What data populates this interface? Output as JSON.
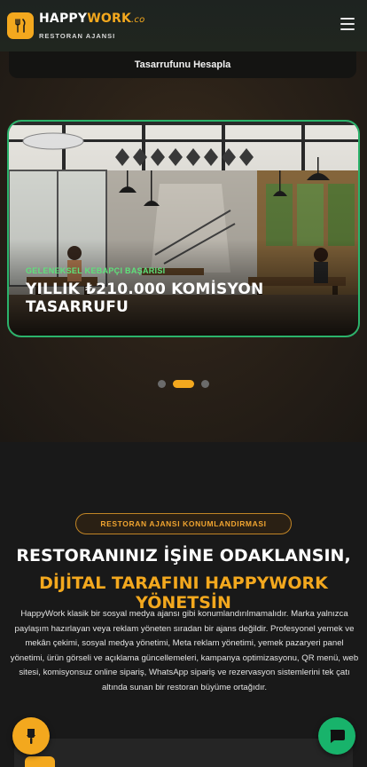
{
  "header": {
    "brand_part1": "HAPPY",
    "brand_part2": "WORK",
    "brand_part3": ".co",
    "subtitle": "RESTORAN AJANSI",
    "logo_icon": "fork-knife-icon",
    "menu_icon": "hamburger-menu-icon"
  },
  "hero": {
    "calc_button": "Tasarrufunu Hesapla",
    "slide": {
      "kicker": "GELENEKSEL KEBAPÇI BAŞARISI",
      "title": "YILLIK ₺210.000 KOMİSYON TASARRUFU",
      "image": "restaurant-interior-photo"
    },
    "dots_total": 3,
    "dots_active": 2
  },
  "section": {
    "pill": "RESTORAN AJANSI KONUMLANDIRMASI",
    "headline_line1": "RESTORANINIZ İŞİNE ODAKLANSIN,",
    "headline_line2": "DİJİTAL TARAFINI HAPPYWORK YÖNETSİN",
    "paragraph": "HappyWork klasik bir sosyal medya ajansı gibi konumlandırılmamalıdır. Marka yalnızca paylaşım hazırlayan veya reklam yöneten sıradan bir ajans değildir. Profesyonel yemek ve mekân çekimi, sosyal medya yönetimi, Meta reklam yönetimi, yemek pazaryeri panel yönetimi, ürün görseli ve açıklama güncellemeleri, kampanya optimizasyonu, QR menü, web sitesi, komisyonsuz online sipariş, WhatsApp sipariş ve rezervasyon sistemlerini tek çatı altında sunan bir restoran büyüme ortağıdır."
  },
  "fabs": {
    "left_icon": "brush-icon",
    "right_icon": "chat-bubble-icon"
  },
  "colors": {
    "accent": "#f3a81e",
    "green": "#18b36b",
    "slide_border": "#2bb36b",
    "kicker": "#5ee27a"
  }
}
